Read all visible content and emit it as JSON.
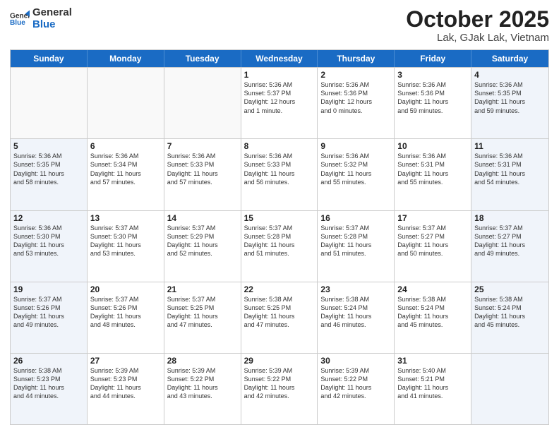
{
  "header": {
    "logo_general": "General",
    "logo_blue": "Blue",
    "month_title": "October 2025",
    "subtitle": "Lak, GJak Lak, Vietnam"
  },
  "weekdays": [
    "Sunday",
    "Monday",
    "Tuesday",
    "Wednesday",
    "Thursday",
    "Friday",
    "Saturday"
  ],
  "rows": [
    [
      {
        "day": "",
        "info": "",
        "empty": true
      },
      {
        "day": "",
        "info": "",
        "empty": true
      },
      {
        "day": "",
        "info": "",
        "empty": true
      },
      {
        "day": "1",
        "info": "Sunrise: 5:36 AM\nSunset: 5:37 PM\nDaylight: 12 hours\nand 1 minute.",
        "empty": false
      },
      {
        "day": "2",
        "info": "Sunrise: 5:36 AM\nSunset: 5:36 PM\nDaylight: 12 hours\nand 0 minutes.",
        "empty": false
      },
      {
        "day": "3",
        "info": "Sunrise: 5:36 AM\nSunset: 5:36 PM\nDaylight: 11 hours\nand 59 minutes.",
        "empty": false
      },
      {
        "day": "4",
        "info": "Sunrise: 5:36 AM\nSunset: 5:35 PM\nDaylight: 11 hours\nand 59 minutes.",
        "empty": false,
        "shaded": true
      }
    ],
    [
      {
        "day": "5",
        "info": "Sunrise: 5:36 AM\nSunset: 5:35 PM\nDaylight: 11 hours\nand 58 minutes.",
        "empty": false,
        "shaded": true
      },
      {
        "day": "6",
        "info": "Sunrise: 5:36 AM\nSunset: 5:34 PM\nDaylight: 11 hours\nand 57 minutes.",
        "empty": false
      },
      {
        "day": "7",
        "info": "Sunrise: 5:36 AM\nSunset: 5:33 PM\nDaylight: 11 hours\nand 57 minutes.",
        "empty": false
      },
      {
        "day": "8",
        "info": "Sunrise: 5:36 AM\nSunset: 5:33 PM\nDaylight: 11 hours\nand 56 minutes.",
        "empty": false
      },
      {
        "day": "9",
        "info": "Sunrise: 5:36 AM\nSunset: 5:32 PM\nDaylight: 11 hours\nand 55 minutes.",
        "empty": false
      },
      {
        "day": "10",
        "info": "Sunrise: 5:36 AM\nSunset: 5:31 PM\nDaylight: 11 hours\nand 55 minutes.",
        "empty": false
      },
      {
        "day": "11",
        "info": "Sunrise: 5:36 AM\nSunset: 5:31 PM\nDaylight: 11 hours\nand 54 minutes.",
        "empty": false,
        "shaded": true
      }
    ],
    [
      {
        "day": "12",
        "info": "Sunrise: 5:36 AM\nSunset: 5:30 PM\nDaylight: 11 hours\nand 53 minutes.",
        "empty": false,
        "shaded": true
      },
      {
        "day": "13",
        "info": "Sunrise: 5:37 AM\nSunset: 5:30 PM\nDaylight: 11 hours\nand 53 minutes.",
        "empty": false
      },
      {
        "day": "14",
        "info": "Sunrise: 5:37 AM\nSunset: 5:29 PM\nDaylight: 11 hours\nand 52 minutes.",
        "empty": false
      },
      {
        "day": "15",
        "info": "Sunrise: 5:37 AM\nSunset: 5:28 PM\nDaylight: 11 hours\nand 51 minutes.",
        "empty": false
      },
      {
        "day": "16",
        "info": "Sunrise: 5:37 AM\nSunset: 5:28 PM\nDaylight: 11 hours\nand 51 minutes.",
        "empty": false
      },
      {
        "day": "17",
        "info": "Sunrise: 5:37 AM\nSunset: 5:27 PM\nDaylight: 11 hours\nand 50 minutes.",
        "empty": false
      },
      {
        "day": "18",
        "info": "Sunrise: 5:37 AM\nSunset: 5:27 PM\nDaylight: 11 hours\nand 49 minutes.",
        "empty": false,
        "shaded": true
      }
    ],
    [
      {
        "day": "19",
        "info": "Sunrise: 5:37 AM\nSunset: 5:26 PM\nDaylight: 11 hours\nand 49 minutes.",
        "empty": false,
        "shaded": true
      },
      {
        "day": "20",
        "info": "Sunrise: 5:37 AM\nSunset: 5:26 PM\nDaylight: 11 hours\nand 48 minutes.",
        "empty": false
      },
      {
        "day": "21",
        "info": "Sunrise: 5:37 AM\nSunset: 5:25 PM\nDaylight: 11 hours\nand 47 minutes.",
        "empty": false
      },
      {
        "day": "22",
        "info": "Sunrise: 5:38 AM\nSunset: 5:25 PM\nDaylight: 11 hours\nand 47 minutes.",
        "empty": false
      },
      {
        "day": "23",
        "info": "Sunrise: 5:38 AM\nSunset: 5:24 PM\nDaylight: 11 hours\nand 46 minutes.",
        "empty": false
      },
      {
        "day": "24",
        "info": "Sunrise: 5:38 AM\nSunset: 5:24 PM\nDaylight: 11 hours\nand 45 minutes.",
        "empty": false
      },
      {
        "day": "25",
        "info": "Sunrise: 5:38 AM\nSunset: 5:24 PM\nDaylight: 11 hours\nand 45 minutes.",
        "empty": false,
        "shaded": true
      }
    ],
    [
      {
        "day": "26",
        "info": "Sunrise: 5:38 AM\nSunset: 5:23 PM\nDaylight: 11 hours\nand 44 minutes.",
        "empty": false,
        "shaded": true
      },
      {
        "day": "27",
        "info": "Sunrise: 5:39 AM\nSunset: 5:23 PM\nDaylight: 11 hours\nand 44 minutes.",
        "empty": false
      },
      {
        "day": "28",
        "info": "Sunrise: 5:39 AM\nSunset: 5:22 PM\nDaylight: 11 hours\nand 43 minutes.",
        "empty": false
      },
      {
        "day": "29",
        "info": "Sunrise: 5:39 AM\nSunset: 5:22 PM\nDaylight: 11 hours\nand 42 minutes.",
        "empty": false
      },
      {
        "day": "30",
        "info": "Sunrise: 5:39 AM\nSunset: 5:22 PM\nDaylight: 11 hours\nand 42 minutes.",
        "empty": false
      },
      {
        "day": "31",
        "info": "Sunrise: 5:40 AM\nSunset: 5:21 PM\nDaylight: 11 hours\nand 41 minutes.",
        "empty": false
      },
      {
        "day": "",
        "info": "",
        "empty": true,
        "shaded": true
      }
    ]
  ]
}
